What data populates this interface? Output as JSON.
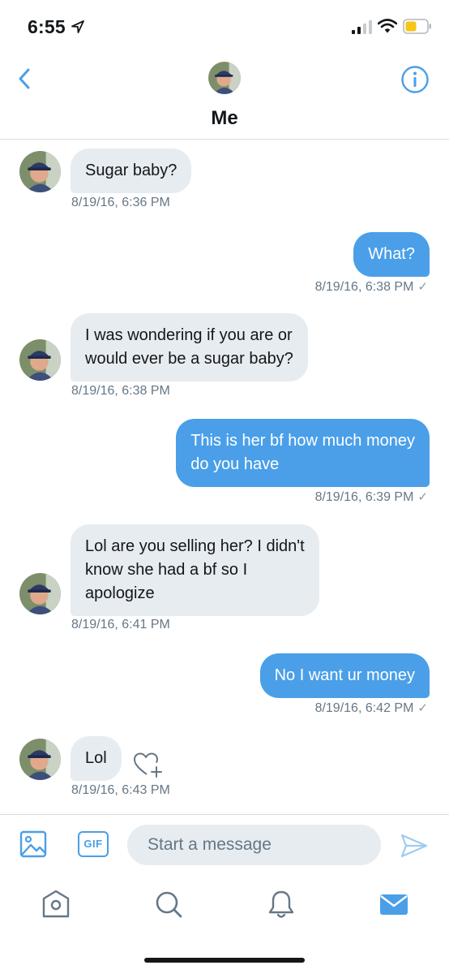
{
  "status_bar": {
    "time": "6:55",
    "icons": [
      "location-arrow-icon",
      "signal-icon",
      "wifi-icon",
      "battery-icon"
    ]
  },
  "header": {
    "title": "Me",
    "left_icon": "chevron-left-icon",
    "right_icon": "info-icon"
  },
  "colors": {
    "accent": "#4a9fe8",
    "incoming_bubble": "#e6ecf0",
    "meta_text": "#657786",
    "battery": "#f5c518"
  },
  "messages": [
    {
      "direction": "in",
      "lines": [
        "Sugar baby?"
      ],
      "meta": "8/19/16, 6:36 PM"
    },
    {
      "direction": "out",
      "lines": [
        "What?"
      ],
      "meta": "8/19/16, 6:38 PM"
    },
    {
      "direction": "in",
      "lines": [
        "I was wondering if you are or",
        "would ever be a sugar baby?"
      ],
      "meta": "8/19/16, 6:38 PM"
    },
    {
      "direction": "out",
      "lines": [
        "This is her bf how much money",
        "do you have"
      ],
      "meta": "8/19/16, 6:39 PM"
    },
    {
      "direction": "in",
      "lines": [
        "Lol are you selling her? I didn't",
        "know she had a bf so I",
        "apologize"
      ],
      "meta": "8/19/16, 6:41 PM"
    },
    {
      "direction": "out",
      "lines": [
        "No I want ur money"
      ],
      "meta": "8/19/16, 6:42 PM"
    },
    {
      "direction": "in",
      "lines": [
        "Lol"
      ],
      "meta": "8/19/16, 6:43 PM"
    }
  ],
  "read_check": "✓",
  "composer": {
    "media_icon": "image-icon",
    "gif_label": "GIF",
    "placeholder": "Start a message",
    "send_icon": "send-icon"
  },
  "tabs": [
    "home-icon",
    "search-icon",
    "bell-icon",
    "mail-icon"
  ]
}
